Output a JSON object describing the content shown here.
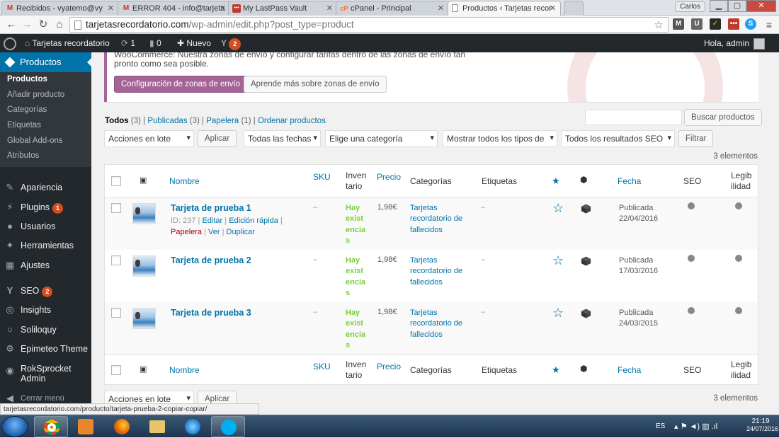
{
  "browser": {
    "tabs": [
      {
        "title": "Recibidos - vyatemo@vy",
        "icon": "M",
        "icon_color": "#d93025"
      },
      {
        "title": "ERROR 404 - info@tarjeta",
        "icon": "M",
        "icon_color": "#d93025"
      },
      {
        "title": "My LastPass Vault",
        "icon": "•••",
        "icon_color": "#c0392b"
      },
      {
        "title": "cPanel - Principal",
        "icon": "cP",
        "icon_color": "#ff6c2c"
      },
      {
        "title": "Productos ‹ Tarjetas recor",
        "icon": "▭",
        "icon_color": "#888888"
      }
    ],
    "user": "Carlos",
    "url_host": "tarjetasrecordatorio.com",
    "url_path": "/wp-admin/edit.php?post_type=product",
    "status_url": "tarjetasrecordatorio.com/producto/tarjeta-prueba-2-copiar-copiar/"
  },
  "adminbar": {
    "site_name": "Tarjetas recordatorio",
    "updates_count": "1",
    "comments_count": "0",
    "new_label": "Nuevo",
    "yoast_count": "2",
    "greeting": "Hola, admin"
  },
  "sidebar": {
    "current": "Productos",
    "submenu": [
      "Productos",
      "Añadir producto",
      "Categorías",
      "Etiquetas",
      "Global Add-ons",
      "Atributos"
    ],
    "items": [
      {
        "label": "Apariencia",
        "icon": "brush-icon"
      },
      {
        "label": "Plugins",
        "icon": "plugin-icon",
        "badge": "1"
      },
      {
        "label": "Usuarios",
        "icon": "users-icon"
      },
      {
        "label": "Herramientas",
        "icon": "tools-icon"
      },
      {
        "label": "Ajustes",
        "icon": "settings-icon"
      },
      {
        "label": "SEO",
        "icon": "yoast-icon",
        "badge": "2"
      },
      {
        "label": "Insights",
        "icon": "insights-icon"
      },
      {
        "label": "Soliloquy",
        "icon": "soliloquy-icon"
      },
      {
        "label": "Epimeteo Theme",
        "icon": "gear-icon"
      },
      {
        "label": "RokSprocket Admin",
        "icon": "roksprocket-icon"
      }
    ],
    "collapse_label": "Cerrar menú"
  },
  "notice": {
    "cut_text": "WooCommerce: Nuestra zonas de envío y configurar tarifas dentro de las zonas de envío tan",
    "text": "pronto como sea posible.",
    "primary_button": "Configuración de zonas de envío",
    "secondary_button": "Aprende más sobre zonas de envío"
  },
  "filters": {
    "all_label": "Todos",
    "all_count": "(3)",
    "published_label": "Publicadas",
    "published_count": "(3)",
    "trash_label": "Papelera",
    "trash_count": "(1)",
    "sort_label": "Ordenar productos",
    "search_button": "Buscar productos",
    "bulk_actions": "Acciones en lote",
    "apply": "Aplicar",
    "all_dates": "Todas las fechas",
    "category": "Elige una categoría",
    "types": "Mostrar todos los tipos de",
    "seo_results": "Todos los resultados SEO",
    "filter_button": "Filtrar",
    "items_count": "3 elementos"
  },
  "table": {
    "headers": {
      "name": "Nombre",
      "sku": "SKU",
      "inventory": "Inven tario",
      "price": "Precio",
      "categories": "Categorías",
      "tags": "Etiquetas",
      "date": "Fecha",
      "seo": "SEO",
      "readability": "Legib ilidad"
    },
    "rows": [
      {
        "name": "Tarjeta de prueba 1",
        "id": "ID: 237",
        "edit": "Editar",
        "quick_edit": "Edición rápida",
        "trash": "Papelera",
        "view": "Ver",
        "duplicate": "Duplicar",
        "sku": "–",
        "stock": "Hay exist encia s",
        "price": "1,98€",
        "category": "Tarjetas recordatorio de fallecidos",
        "tags": "–",
        "status": "Publicada",
        "date": "22/04/2016"
      },
      {
        "name": "Tarjeta de prueba 2",
        "sku": "–",
        "stock": "Hay exist encia s",
        "price": "1,98€",
        "category": "Tarjetas recordatorio de fallecidos",
        "tags": "–",
        "status": "Publicada",
        "date": "17/03/2016"
      },
      {
        "name": "Tarjeta de prueba 3",
        "sku": "–",
        "stock": "Hay exist encia s",
        "price": "1,98€",
        "category": "Tarjetas recordatorio de fallecidos",
        "tags": "–",
        "status": "Publicada",
        "date": "24/03/2015"
      }
    ]
  },
  "taskbar": {
    "lang": "ES",
    "time": "21:19",
    "date": "24/07/2016"
  },
  "colors": {
    "wp_blue": "#0073aa",
    "woo_purple": "#a46497",
    "in_stock_green": "#7ad03a",
    "admin_dark": "#23282d"
  }
}
